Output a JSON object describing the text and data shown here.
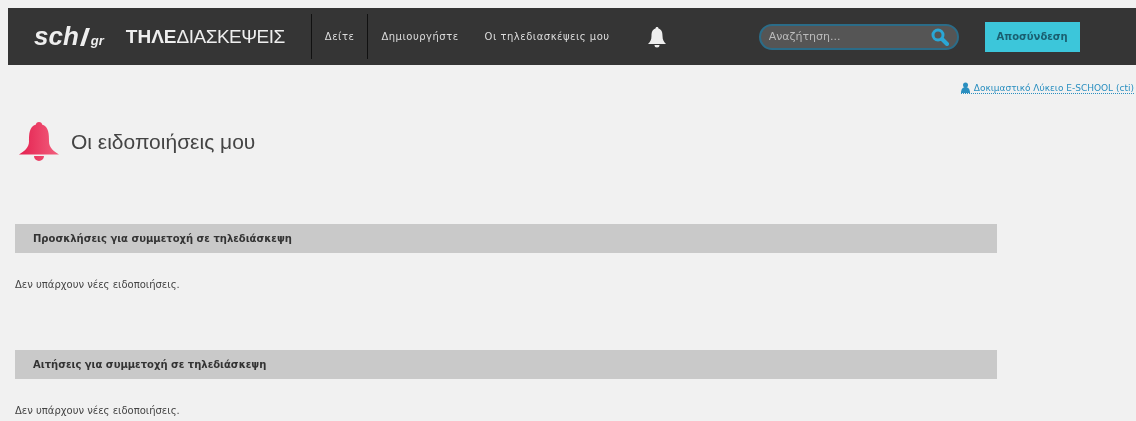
{
  "header": {
    "logo": {
      "brand": "sch",
      "domain": "gr",
      "service_bold": "ΤΗΛΕ",
      "service_light": "ΔΙΑΣΚΕΨΕΙΣ"
    },
    "nav": [
      {
        "label": "Δείτε"
      },
      {
        "label": "Δημιουργήστε"
      },
      {
        "label": "Οι τηλεδιασκέψεις μου"
      }
    ],
    "search": {
      "placeholder": "Αναζήτηση..."
    },
    "logout_button": "Αποσύνδεση"
  },
  "user_link": "Δοκιμαστικό Λύκειο E-SCHOOL (cti)",
  "page_title": "Οι ειδοποιήσεις μου",
  "sections": [
    {
      "title": "Προσκλήσεις για συμμετοχή σε τηλεδιάσκεψη",
      "message": "Δεν υπάρχουν νέες ειδοποιήσεις."
    },
    {
      "title": "Αιτήσεις για συμμετοχή σε τηλεδιάσκεψη",
      "message": "Δεν υπάρχουν νέες ειδοποιήσεις."
    }
  ]
}
